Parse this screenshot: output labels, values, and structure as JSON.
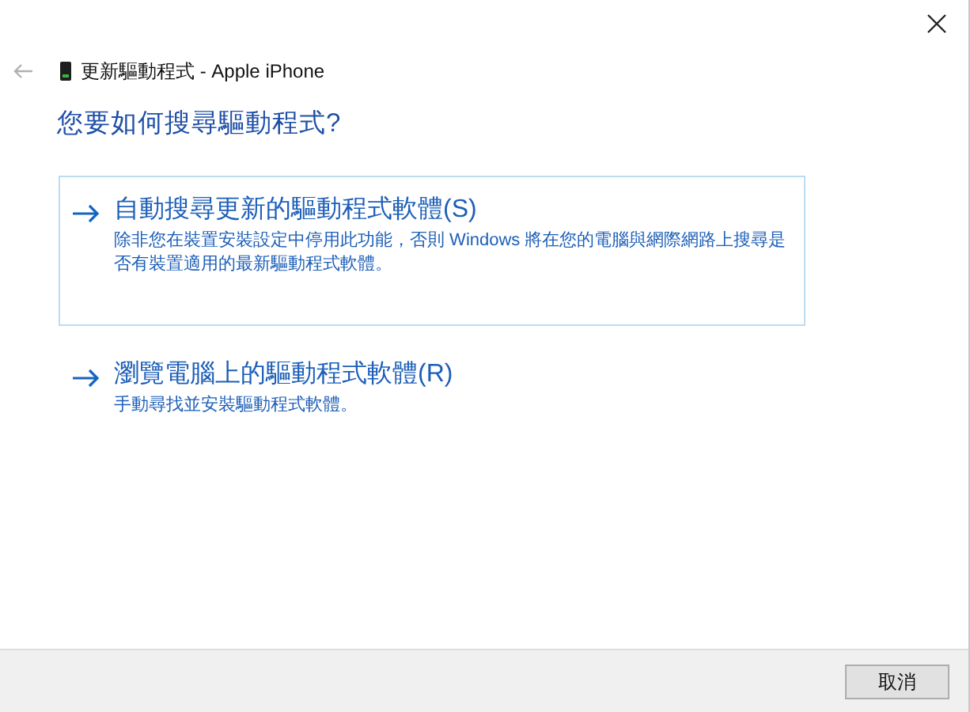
{
  "header": {
    "title": "更新驅動程式 - Apple iPhone"
  },
  "heading": "您要如何搜尋驅動程式?",
  "options": [
    {
      "title": "自動搜尋更新的驅動程式軟體(S)",
      "description": "除非您在裝置安裝設定中停用此功能，否則 Windows 將在您的電腦與網際網路上搜尋是否有裝置適用的最新驅動程式軟體。",
      "selected": true
    },
    {
      "title": "瀏覽電腦上的驅動程式軟體(R)",
      "description": "手動尋找並安裝驅動程式軟體。",
      "selected": false
    }
  ],
  "buttons": [
    "取消"
  ]
}
